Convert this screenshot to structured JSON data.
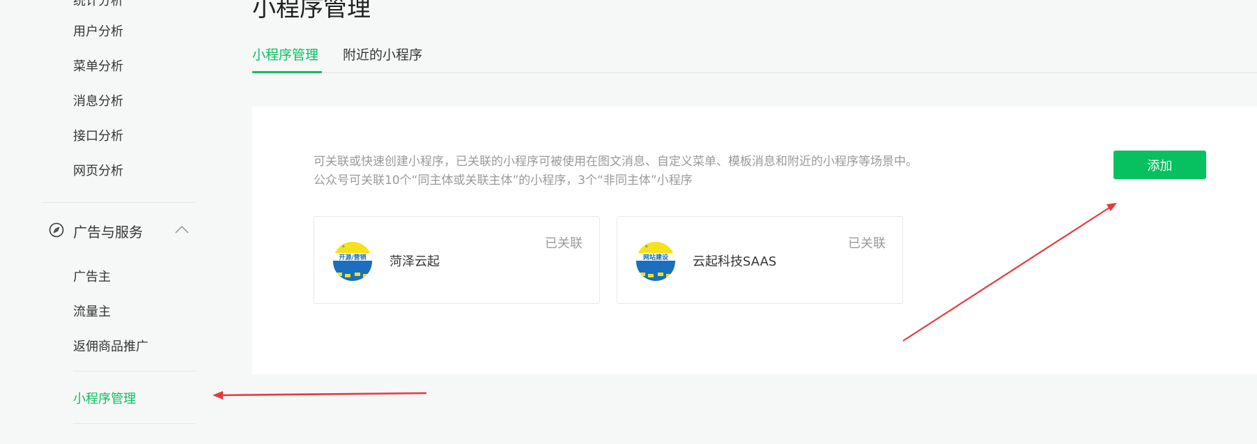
{
  "sidebar": {
    "partial_top_label": "统计分析",
    "items_top": [
      {
        "label": "用户分析"
      },
      {
        "label": "菜单分析"
      },
      {
        "label": "消息分析"
      },
      {
        "label": "接口分析"
      },
      {
        "label": "网页分析"
      }
    ],
    "group": {
      "icon": "compass-icon",
      "label": "广告与服务",
      "chevron": "chevron-up-icon",
      "items": [
        {
          "label": "广告主"
        },
        {
          "label": "流量主"
        },
        {
          "label": "返佣商品推广"
        }
      ]
    },
    "active_item": {
      "label": "小程序管理"
    }
  },
  "main": {
    "title": "小程序管理",
    "tabs": [
      {
        "label": "小程序管理",
        "active": true
      },
      {
        "label": "附近的小程序",
        "active": false
      }
    ],
    "description": {
      "line1": "可关联或快速创建小程序，已关联的小程序可被使用在图文消息、自定义菜单、模板消息和附近的小程序等场景中。",
      "line2": "公众号可关联10个“同主体或关联主体”的小程序，3个“非同主体”小程序"
    },
    "add_button": "添加",
    "cards": [
      {
        "name": "菏泽云起",
        "status": "已关联",
        "avatar_text": "开源/营销",
        "avatar_icon": "mini-program-avatar-icon"
      },
      {
        "name": "云起科技SAAS",
        "status": "已关联",
        "avatar_text": "网站建设",
        "avatar_icon": "mini-program-avatar-icon"
      }
    ]
  },
  "colors": {
    "accent": "#07c160",
    "annotation_arrow": "#e8383d",
    "background": "#f6f7f7"
  }
}
